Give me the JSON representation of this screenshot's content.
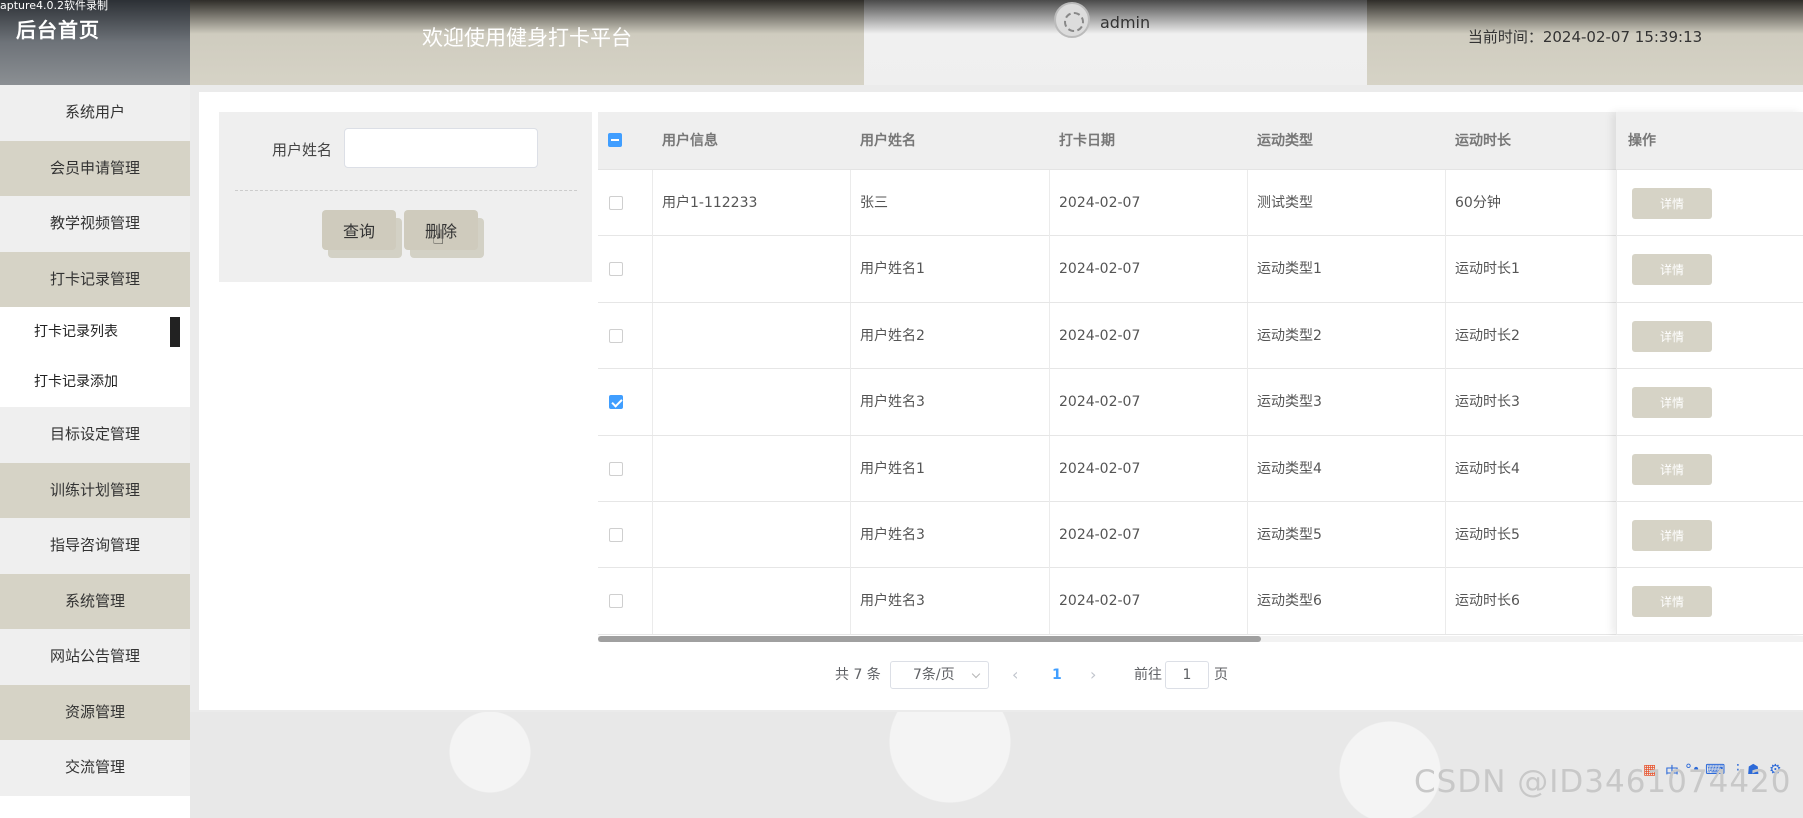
{
  "recorder_text": "apture4.0.2软件录制",
  "header": {
    "brand": "后台首页",
    "welcome": "欢迎使用健身打卡平台",
    "username": "admin",
    "time_label": "当前时间：2024-02-07 15:39:13"
  },
  "sidebar": {
    "items": [
      {
        "label": "系统用户"
      },
      {
        "label": "会员申请管理"
      },
      {
        "label": "教学视频管理"
      },
      {
        "label": "打卡记录管理"
      },
      {
        "label": "打卡记录列表"
      },
      {
        "label": "打卡记录添加"
      },
      {
        "label": "目标设定管理"
      },
      {
        "label": "训练计划管理"
      },
      {
        "label": "指导咨询管理"
      },
      {
        "label": "系统管理"
      },
      {
        "label": "网站公告管理"
      },
      {
        "label": "资源管理"
      },
      {
        "label": "交流管理"
      }
    ]
  },
  "search": {
    "label": "用户姓名",
    "value": "",
    "query_label": "查询",
    "delete_label": "删除"
  },
  "table": {
    "columns": [
      "用户信息",
      "用户姓名",
      "打卡日期",
      "运动类型",
      "运动时长",
      "操作"
    ],
    "detail_label": "详情",
    "rows": [
      {
        "checked": false,
        "user_info": "用户1-112233",
        "name": "张三",
        "date": "2024-02-07",
        "type": "测试类型",
        "duration": "60分钟"
      },
      {
        "checked": false,
        "user_info": "",
        "name": "用户姓名1",
        "date": "2024-02-07",
        "type": "运动类型1",
        "duration": "运动时长1"
      },
      {
        "checked": false,
        "user_info": "",
        "name": "用户姓名2",
        "date": "2024-02-07",
        "type": "运动类型2",
        "duration": "运动时长2"
      },
      {
        "checked": true,
        "user_info": "",
        "name": "用户姓名3",
        "date": "2024-02-07",
        "type": "运动类型3",
        "duration": "运动时长3"
      },
      {
        "checked": false,
        "user_info": "",
        "name": "用户姓名1",
        "date": "2024-02-07",
        "type": "运动类型4",
        "duration": "运动时长4"
      },
      {
        "checked": false,
        "user_info": "",
        "name": "用户姓名3",
        "date": "2024-02-07",
        "type": "运动类型5",
        "duration": "运动时长5"
      },
      {
        "checked": false,
        "user_info": "",
        "name": "用户姓名3",
        "date": "2024-02-07",
        "type": "运动类型6",
        "duration": "运动时长6"
      }
    ]
  },
  "pagination": {
    "total": "共 7 条",
    "page_size": "7条/页",
    "current_page": "1",
    "goto_prefix": "前往",
    "goto_value": "1",
    "goto_suffix": "页"
  },
  "watermark": "CSDN @ID3461074420",
  "colors": {
    "accent_tan": "#d6d3c6",
    "checkbox_blue": "#409eff"
  }
}
